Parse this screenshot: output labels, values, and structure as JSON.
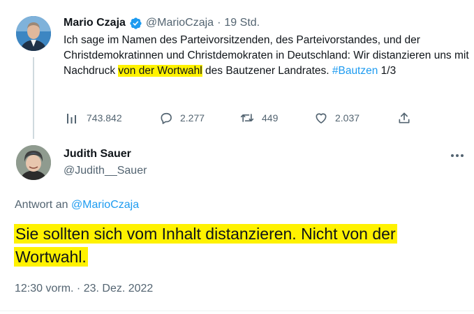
{
  "tweet": {
    "author_name": "Mario Czaja",
    "author_handle": "@MarioCzaja",
    "separator": "·",
    "time_ago": "19 Std.",
    "text_part1": "Ich sage im Namen des Parteivorsitzenden, des Parteivorstandes, und der Christdemokratinnen und Christdemokraten in Deutschland: Wir distanzieren uns mit Nachdruck ",
    "text_highlight": "von der Wortwahl",
    "text_part2": " des Bautzener Landrates. ",
    "hashtag": "#Bautzen",
    "text_part3": " 1/3",
    "stats": {
      "views": "743.842",
      "replies": "2.277",
      "retweets": "449",
      "likes": "2.037"
    }
  },
  "reply": {
    "author_name": "Judith Sauer",
    "author_handle": "@Judith__Sauer",
    "replying_to_label": "Antwort an",
    "replying_to_handle": "@MarioCzaja",
    "text": "Sie sollten sich vom Inhalt distanzieren. Nicht von der Wortwahl.",
    "timestamp": "12:30 vorm. · 23. Dez. 2022"
  },
  "colors": {
    "accent": "#1d9bf0",
    "highlight": "#fff200",
    "secondary_text": "#536471"
  },
  "icons": {
    "verified": "verified-badge-icon",
    "views": "bar-chart-icon",
    "reply": "speech-bubble-icon",
    "retweet": "retweet-arrows-icon",
    "like": "heart-icon",
    "share": "share-upload-icon",
    "more": "more-dots-icon"
  }
}
